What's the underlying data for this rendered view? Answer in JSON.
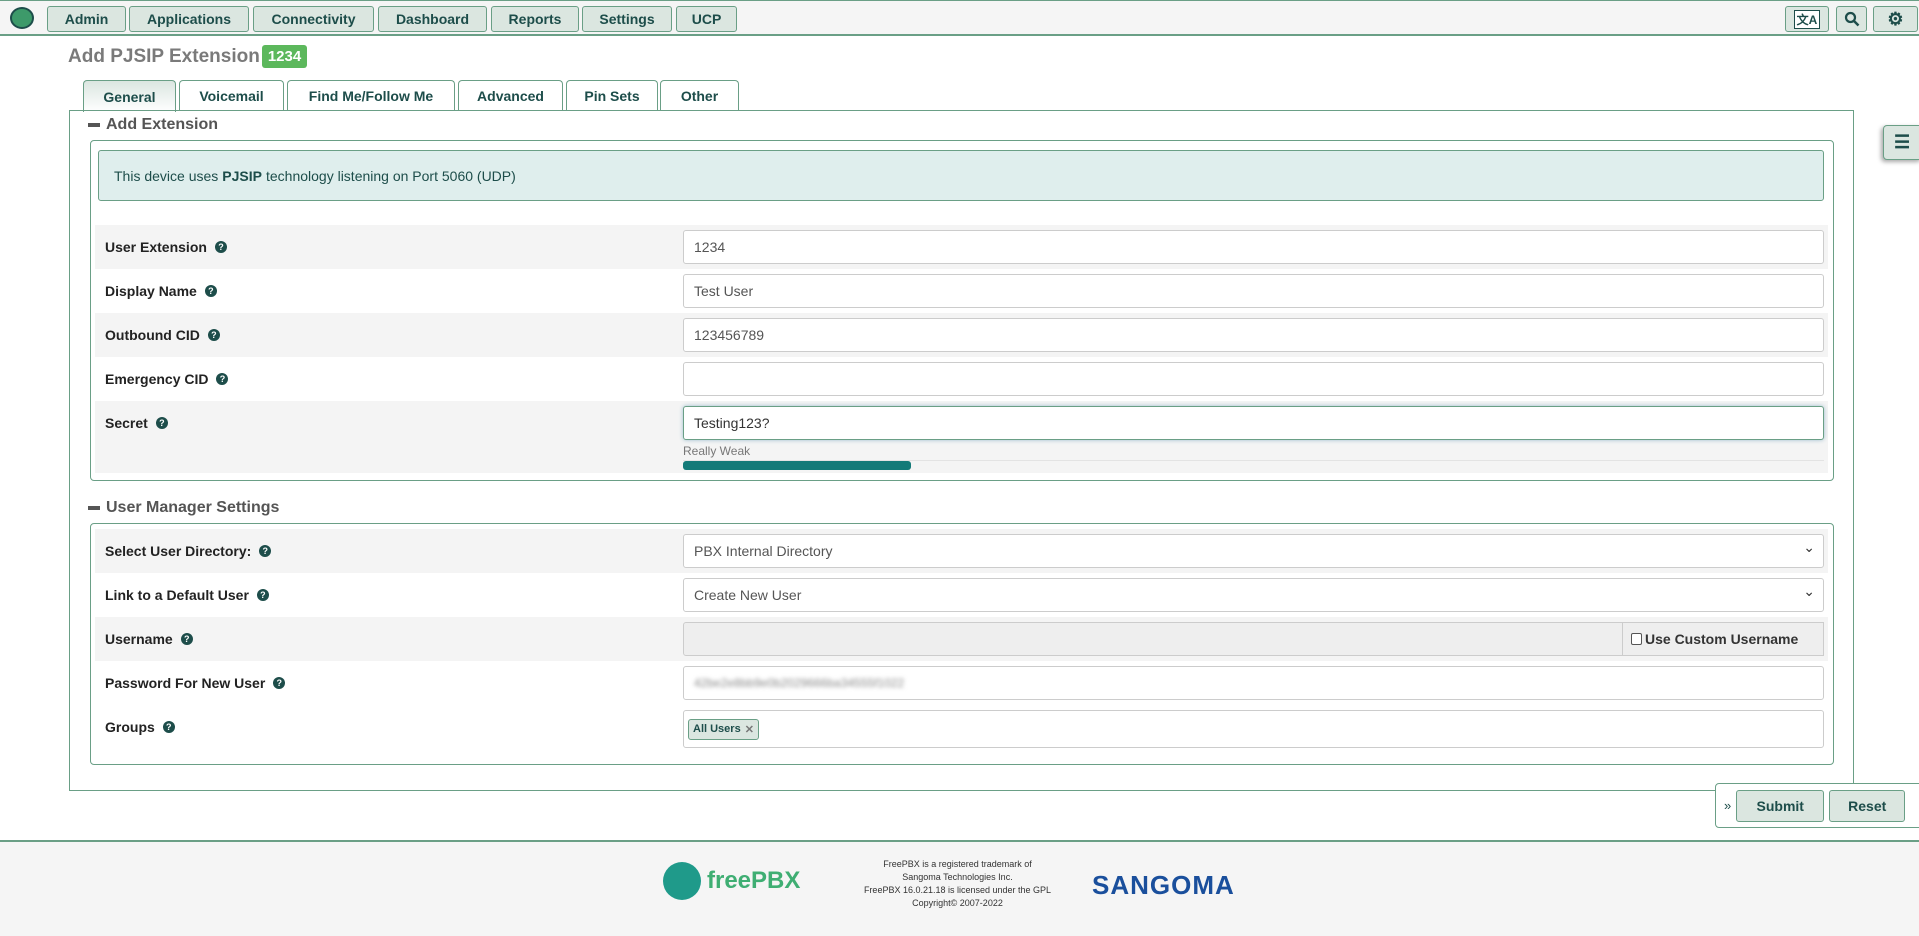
{
  "nav": {
    "items": [
      "Admin",
      "Applications",
      "Connectivity",
      "Dashboard",
      "Reports",
      "Settings",
      "UCP"
    ],
    "icons": [
      "translate-icon",
      "search-icon",
      "gear-icon"
    ]
  },
  "title": {
    "text": "Add PJSIP Extension",
    "badge": "1234"
  },
  "tabs": [
    "General",
    "Voicemail",
    "Find Me/Follow Me",
    "Advanced",
    "Pin Sets",
    "Other"
  ],
  "add_extension": {
    "header": "Add Extension",
    "info_pre": "This device uses ",
    "info_bold": "PJSIP",
    "info_post": " technology listening on Port 5060 (UDP)",
    "fields": [
      {
        "label": "User Extension",
        "value": "1234"
      },
      {
        "label": "Display Name",
        "value": "Test User"
      },
      {
        "label": "Outbound CID",
        "value": "123456789"
      },
      {
        "label": "Emergency CID",
        "value": ""
      },
      {
        "label": "Secret",
        "value": "Testing123?"
      }
    ],
    "strength_label": "Really Weak",
    "strength_percent": 20
  },
  "user_manager": {
    "header": "User Manager Settings",
    "directory_label": "Select User Directory:",
    "directory_value": "PBX Internal Directory",
    "link_label": "Link to a Default User",
    "link_value": "Create New User",
    "username_label": "Username",
    "custom_username_label": "Use Custom Username",
    "password_label": "Password For New User",
    "password_value": "42be2e8bb9e0b2029666ba34555f1022",
    "groups_label": "Groups",
    "groups": [
      "All Users"
    ]
  },
  "actions": {
    "submit": "Submit",
    "reset": "Reset"
  },
  "footer": {
    "lines": [
      "FreePBX is a registered trademark of",
      "Sangoma Technologies Inc.",
      "FreePBX 16.0.21.18 is licensed under the GPL",
      "Copyright© 2007-2022"
    ],
    "logo_left": "freePBX",
    "logo_right": "SANGOMA"
  },
  "colors": {
    "accent": "#6a9f86",
    "button_bg": "#dbe6e0",
    "text_dark": "#1d4d4a",
    "badge": "#5cb85c",
    "strength": "#137a78"
  }
}
